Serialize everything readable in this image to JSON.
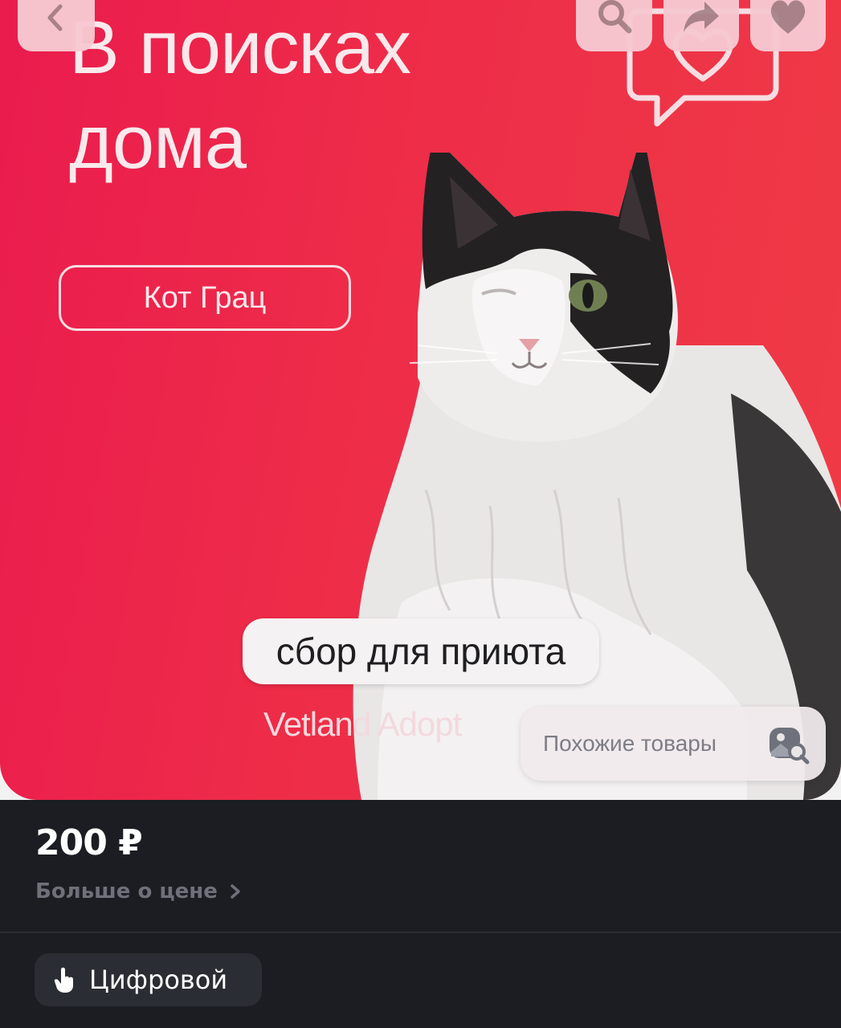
{
  "poster": {
    "title_line1": "В поисках",
    "title_line2": "дома",
    "cat_name": "Кот Грац",
    "collect_label": "сбор для приюта",
    "organization": "Vetland Adopt"
  },
  "toolbar": {
    "back_icon": "chevron-left-icon",
    "search_icon": "search-icon",
    "share_icon": "share-icon",
    "favorite_icon": "heart-icon"
  },
  "similar": {
    "label": "Похожие товары",
    "icon": "image-search-icon"
  },
  "product": {
    "price": "200 ₽",
    "more_price_label": "Больше о цене",
    "type_label": "Цифровой"
  },
  "colors": {
    "poster_red": "#ee2d48",
    "button_pink": "#f7c9d2",
    "background_dark": "#1b1d22",
    "chip_dark": "#2a2d33"
  }
}
